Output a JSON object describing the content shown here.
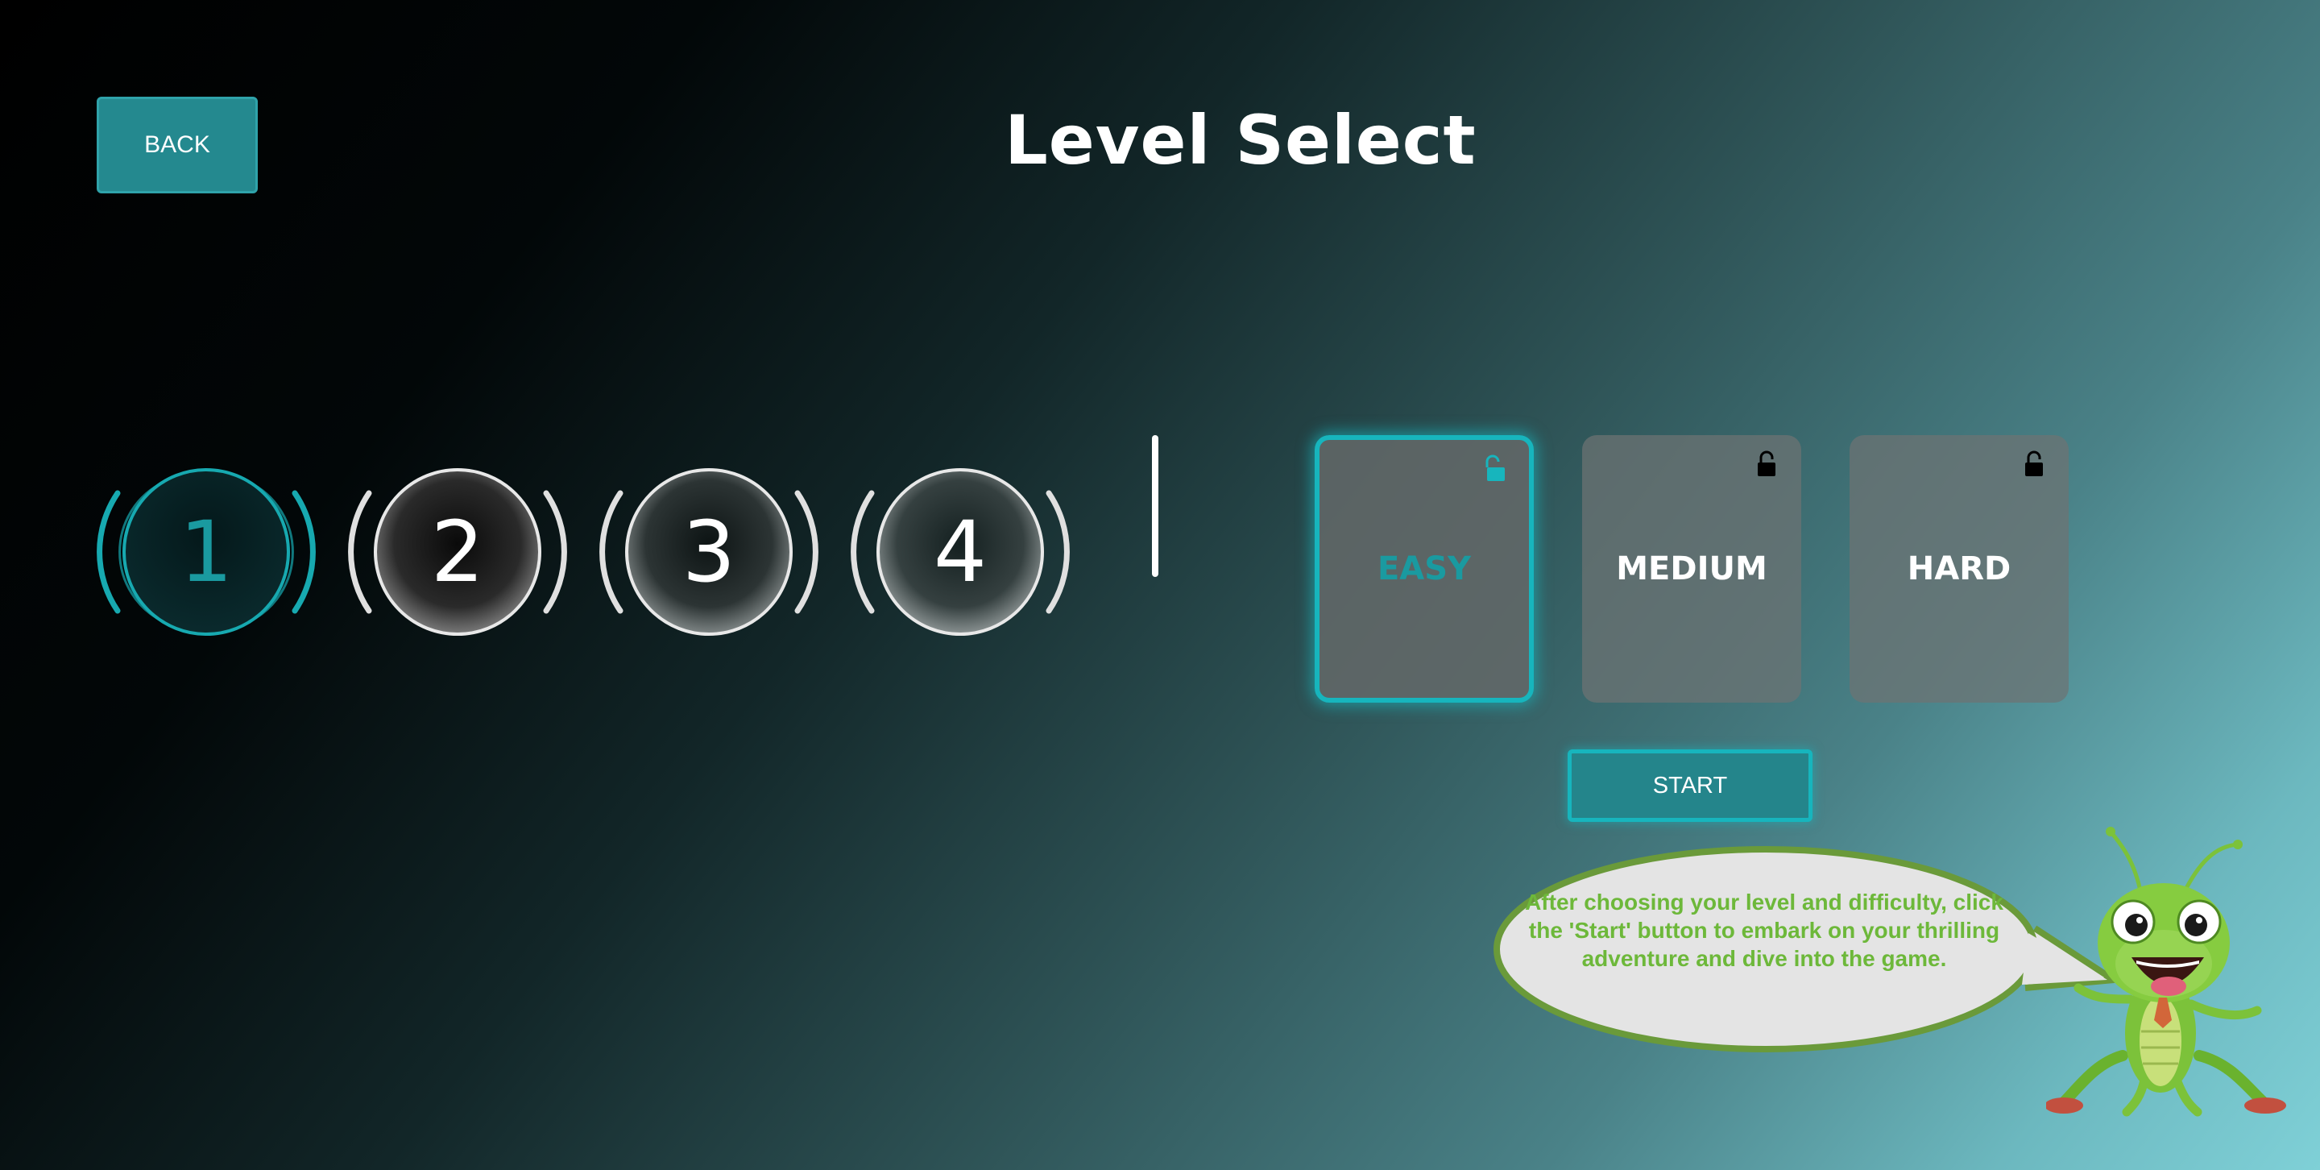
{
  "header": {
    "back_label": "BACK",
    "title": "Level Select"
  },
  "levels": [
    {
      "label": "1",
      "selected": true
    },
    {
      "label": "2",
      "selected": false
    },
    {
      "label": "3",
      "selected": false
    },
    {
      "label": "4",
      "selected": false
    }
  ],
  "difficulties": [
    {
      "label": "EASY",
      "selected": true,
      "lock_icon": "unlocked-icon"
    },
    {
      "label": "MEDIUM",
      "selected": false,
      "lock_icon": "locked-icon"
    },
    {
      "label": "HARD",
      "selected": false,
      "lock_icon": "locked-icon"
    }
  ],
  "start_label": "START",
  "mascot": {
    "speech": "After choosing your level and difficulty, click the 'Start' button to embark on your thrilling adventure and dive into the game.",
    "character": "grasshopper-mascot"
  },
  "colors": {
    "accent": "#17b5bd",
    "button_bg": "#24898f",
    "speech_text": "#6db83a",
    "speech_border": "#6a9a3a",
    "speech_bg": "#e4e4e4"
  }
}
